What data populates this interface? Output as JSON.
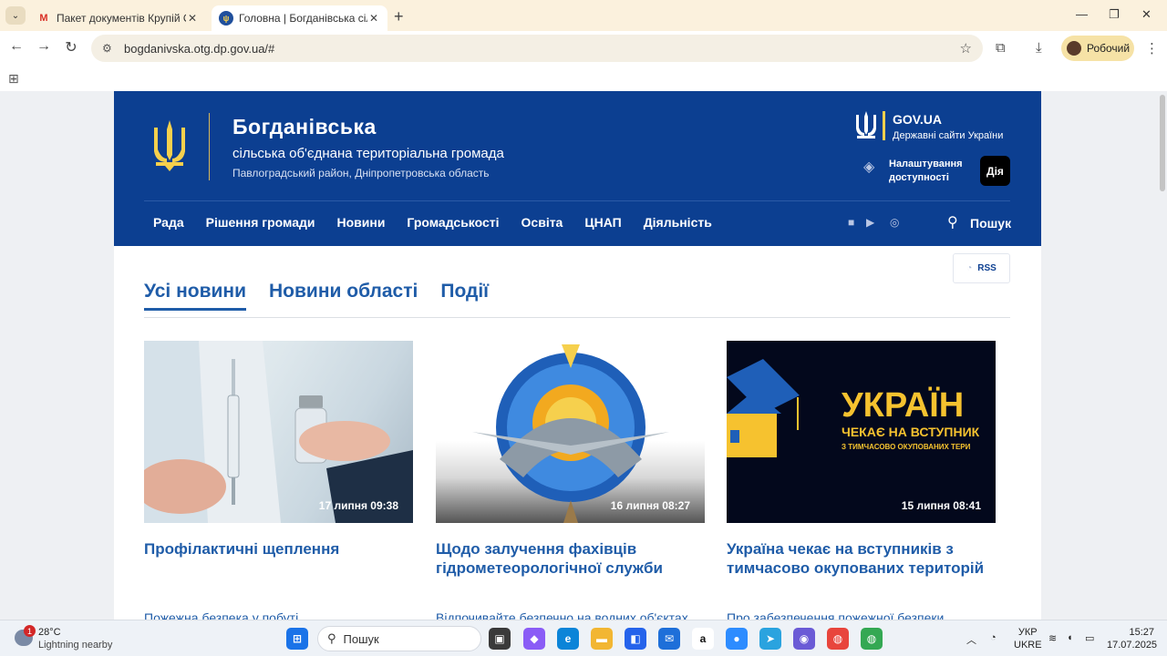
{
  "browser": {
    "tabs": [
      {
        "title": "Пакет документів Крупій Окса",
        "favicon": "gmail-icon"
      },
      {
        "title": "Головна | Богданівська сільськ",
        "favicon": "trident-icon"
      }
    ],
    "url": "bogdanivska.otg.dp.gov.ua/#",
    "profile_label": "Робочий"
  },
  "site": {
    "title": "Богданівська",
    "subtitle": "сільська об'єднана територіальна громада",
    "region": "Павлоградський район, Дніпропетровська область",
    "gov_title": "GOV.UA",
    "gov_subtitle": "Державні сайти України",
    "accessibility_line1": "Налаштування",
    "accessibility_line2": "доступності",
    "diia_label": "Дія",
    "menu": [
      "Рада",
      "Рішення громади",
      "Новини",
      "Громадськості",
      "Освіта",
      "ЦНАП",
      "Діяльність"
    ],
    "search_label": "Пошук",
    "rss_label": "RSS",
    "colors": {
      "header": "#0c3f91",
      "accent": "#1f5ca8",
      "gold": "#f6d04d"
    }
  },
  "news": {
    "tabs": [
      "Усі новини",
      "Новини області",
      "Події"
    ],
    "active_tab": "Усі новини",
    "cards": [
      {
        "date": "17 липня 09:38",
        "title": "Профілактичні щеплення"
      },
      {
        "date": "16 липня 08:27",
        "title": "Щодо залучення фахівців гідрометеорологічної служби"
      },
      {
        "date": "15 липня 08:41",
        "title": "Україна чекає на вступників з тимчасово окупованих територій"
      }
    ],
    "card3_image_text": {
      "big": "УКРАЇН",
      "mid": "ЧЕКАЄ НА ВСТУПНИК",
      "small": "З ТИМЧАСОВО ОКУПОВАНИХ ТЕРИ"
    },
    "next_titles": [
      "Пожежна безпека у побуті",
      "Відпочивайте безпечно на водних об'єктах",
      "Про забезпечення пожежної безпеки"
    ]
  },
  "taskbar": {
    "weather_temp": "28°C",
    "weather_desc": "Lightning nearby",
    "weather_badge": "1",
    "search_label": "Пошук",
    "lang_line1": "УКР",
    "lang_line2": "UKRE",
    "time": "15:27",
    "date": "17.07.2025"
  }
}
